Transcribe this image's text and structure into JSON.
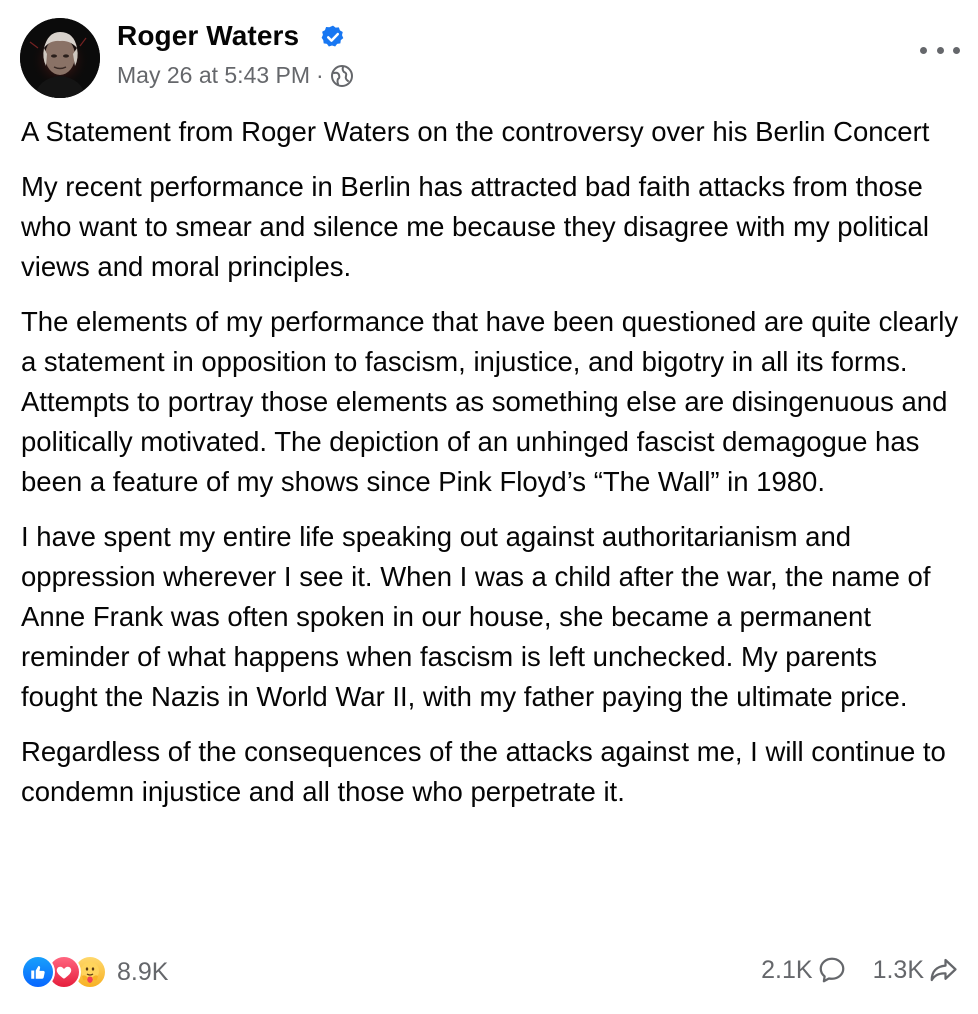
{
  "post": {
    "author": {
      "name": "Roger Waters",
      "verified": true,
      "avatar": "profile-photo"
    },
    "meta": {
      "timestamp": "May 26 at 5:43 PM",
      "separator": "·",
      "audience_icon": "globe-icon"
    },
    "more_icon": "more-horizontal-icon",
    "paragraphs": [
      "A Statement from Roger Waters on the controversy over his Berlin Concert",
      "My recent performance in Berlin has attracted bad faith attacks from those who want to smear and silence me because they disagree with my political views and moral principles.",
      "The elements of my performance that have been questioned are quite clearly a statement in opposition to fascism, injustice, and bigotry in all its forms. Attempts to portray those elements as something else are disingenuous and politically motivated. The depiction of an unhinged fascist demagogue has been a feature of my shows since Pink Floyd’s “The Wall” in 1980.",
      "I have spent my entire life speaking out against authoritarianism and oppression wherever I see it. When I was a child after the war, the name of Anne Frank was often spoken in our house, she became a permanent reminder of what happens when fascism is left unchecked. My parents fought the Nazis in World War II, with my father paying the ultimate price.",
      "Regardless of the consequences of the attacks against me, I will continue to condemn injustice and all those who perpetrate it."
    ],
    "footer": {
      "reactions": [
        "like-icon",
        "love-icon",
        "care-icon"
      ],
      "reaction_count": "8.9K",
      "comment_count": "2.1K",
      "comment_icon": "comment-icon",
      "share_count": "1.3K",
      "share_icon": "share-icon"
    },
    "colors": {
      "text": "#050505",
      "secondary": "#65676b",
      "verified_blue": "#1877f2",
      "like_blue": "#0866ff",
      "love_red": "#f33e58",
      "care_yellow": "#f7b125"
    }
  }
}
